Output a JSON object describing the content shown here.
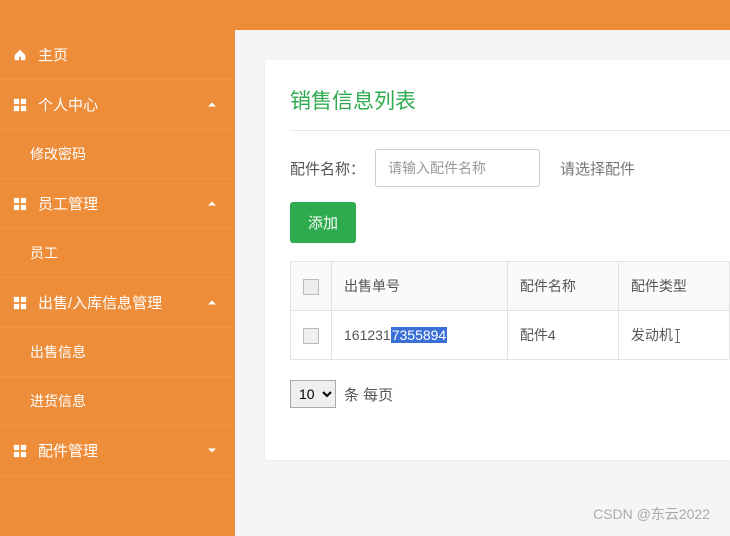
{
  "sidebar": {
    "items": [
      {
        "label": "主页",
        "icon": "home",
        "sub": false,
        "expandable": false
      },
      {
        "label": "个人中心",
        "icon": "grid",
        "sub": false,
        "expandable": true
      },
      {
        "label": "修改密码",
        "icon": null,
        "sub": true,
        "expandable": false
      },
      {
        "label": "员工管理",
        "icon": "grid",
        "sub": false,
        "expandable": true
      },
      {
        "label": "员工",
        "icon": null,
        "sub": true,
        "expandable": false
      },
      {
        "label": "出售/入库信息管理",
        "icon": "grid",
        "sub": false,
        "expandable": true
      },
      {
        "label": "出售信息",
        "icon": null,
        "sub": true,
        "expandable": false
      },
      {
        "label": "进货信息",
        "icon": null,
        "sub": true,
        "expandable": false
      },
      {
        "label": "配件管理",
        "icon": "grid",
        "sub": false,
        "expandable": true
      }
    ]
  },
  "panel": {
    "title": "销售信息列表"
  },
  "filter": {
    "label": "配件名称：",
    "placeholder": "请输入配件名称",
    "select_hint": "请选择配件"
  },
  "buttons": {
    "add": "添加"
  },
  "table": {
    "headers": [
      "出售单号",
      "配件名称",
      "配件类型"
    ],
    "rows": [
      {
        "order_no_prefix": "161231",
        "order_no_highlight": "7355894",
        "name": "配件4",
        "type": "发动机"
      }
    ]
  },
  "pager": {
    "size": "10",
    "label": "条 每页"
  },
  "watermark": "CSDN @东云2022"
}
